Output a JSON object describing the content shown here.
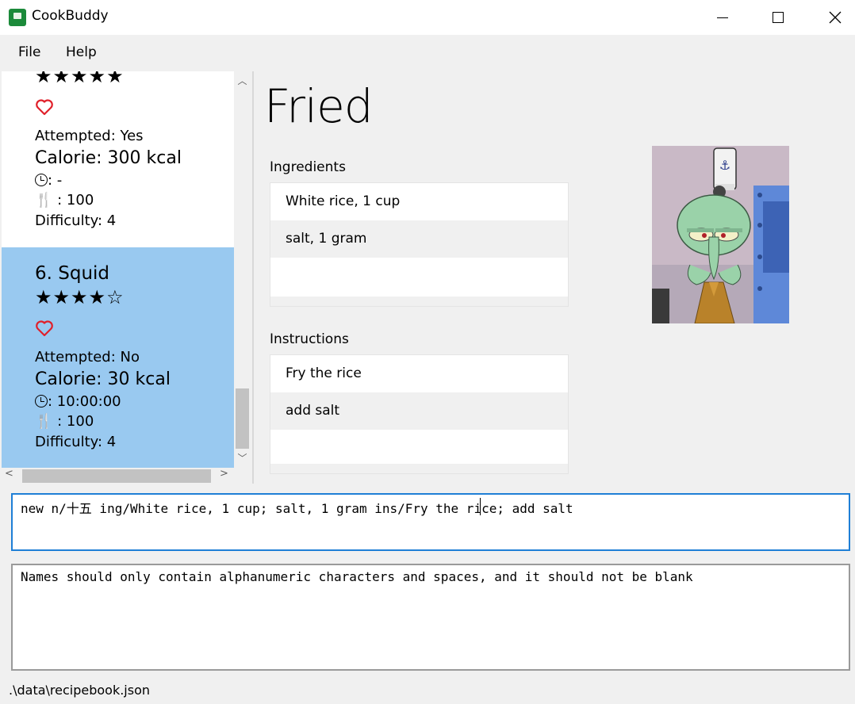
{
  "window": {
    "title": "CookBuddy"
  },
  "menu": {
    "file": "File",
    "help": "Help"
  },
  "list": {
    "prev_card": {
      "stars": "★★★★★",
      "favourite": true,
      "attempted": "Attempted: Yes",
      "calorie": "Calorie: 300 kcal",
      "time": ": -",
      "serving": " : 100",
      "difficulty": "Difficulty: 4"
    },
    "selected_card": {
      "name": "6.  Squid",
      "stars": "★★★★☆",
      "favourite": true,
      "attempted": "Attempted: No",
      "calorie": "Calorie: 30 kcal",
      "time": ": 10:00:00",
      "serving": " : 100",
      "difficulty": "Difficulty: 4"
    },
    "scroll_up_glyph": "︿",
    "scroll_down_glyph": "﹀",
    "scroll_left_glyph": "<",
    "scroll_right_glyph": ">"
  },
  "detail": {
    "title": "Fried",
    "ingredients_label": "Ingredients",
    "ingredients": [
      "White rice, 1 cup",
      "salt, 1 gram"
    ],
    "instructions_label": "Instructions",
    "instructions": [
      "Fry the rice",
      "add salt"
    ]
  },
  "command": {
    "text": "new n/十五 ing/White rice, 1 cup; salt, 1 gram ins/Fry the rice; add salt"
  },
  "result": {
    "text": "Names should only contain alphanumeric characters and spaces, and it should not be blank"
  },
  "status": {
    "path": ".\\data\\recipebook.json"
  },
  "colors": {
    "selected": "#99c9f0",
    "accent": "#1f7fd6",
    "heart": "#e0202a"
  }
}
